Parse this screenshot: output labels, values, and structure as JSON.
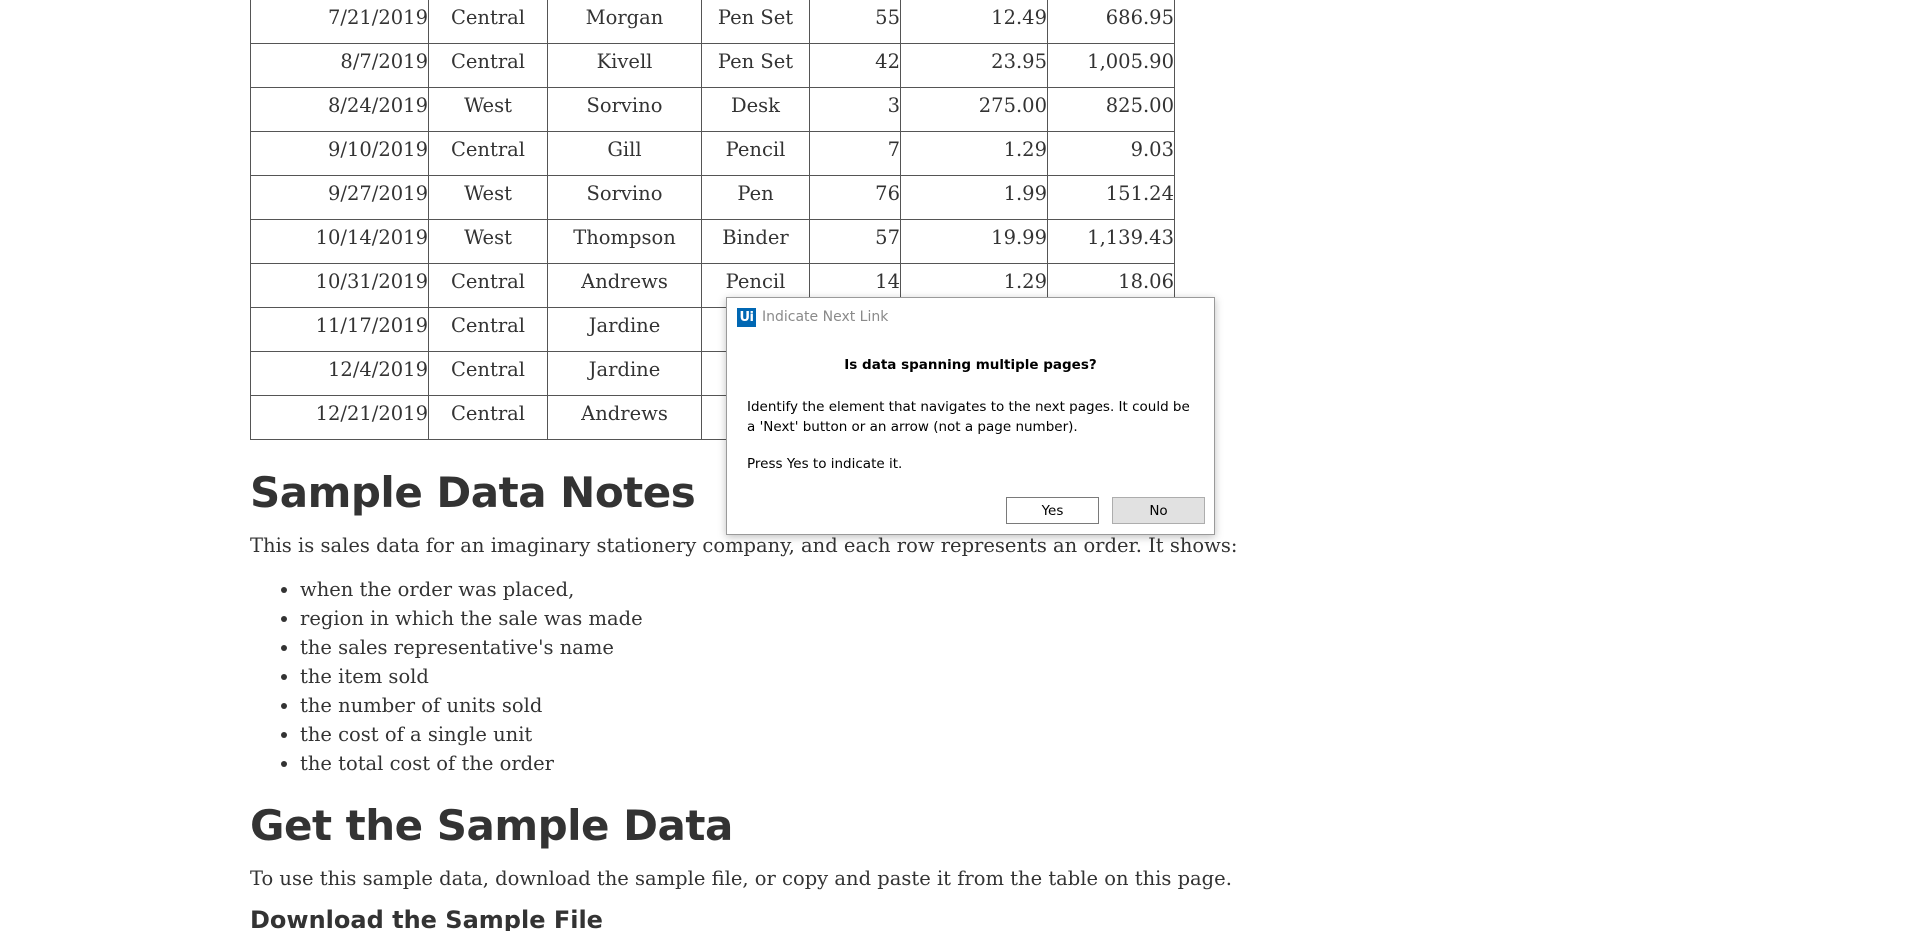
{
  "table": {
    "rows": [
      [
        "7/21/2019",
        "Central",
        "Morgan",
        "Pen Set",
        "55",
        "12.49",
        "686.95"
      ],
      [
        "8/7/2019",
        "Central",
        "Kivell",
        "Pen Set",
        "42",
        "23.95",
        "1,005.90"
      ],
      [
        "8/24/2019",
        "West",
        "Sorvino",
        "Desk",
        "3",
        "275.00",
        "825.00"
      ],
      [
        "9/10/2019",
        "Central",
        "Gill",
        "Pencil",
        "7",
        "1.29",
        "9.03"
      ],
      [
        "9/27/2019",
        "West",
        "Sorvino",
        "Pen",
        "76",
        "1.99",
        "151.24"
      ],
      [
        "10/14/2019",
        "West",
        "Thompson",
        "Binder",
        "57",
        "19.99",
        "1,139.43"
      ],
      [
        "10/31/2019",
        "Central",
        "Andrews",
        "Pencil",
        "14",
        "1.29",
        "18.06"
      ],
      [
        "11/17/2019",
        "Central",
        "Jardine",
        "",
        "",
        "",
        ""
      ],
      [
        "12/4/2019",
        "Central",
        "Jardine",
        "",
        "",
        "",
        ""
      ],
      [
        "12/21/2019",
        "Central",
        "Andrews",
        "",
        "",
        "",
        ""
      ]
    ]
  },
  "notes": {
    "heading": "Sample Data Notes",
    "intro": "This is sales data for an imaginary stationery company, and each row represents an order. It shows:",
    "items": [
      "when the order was placed,",
      "region in which the sale was made",
      "the sales representative's name",
      "the item sold",
      "the number of units sold",
      "the cost of a single unit",
      "the total cost of the order"
    ]
  },
  "get_data": {
    "heading": "Get the Sample Data",
    "intro": "To use this sample data, download the sample file, or copy and paste it from the table on this page.",
    "download_heading": "Download the Sample File"
  },
  "dialog": {
    "app_icon_text": "Ui",
    "app_icon_color": "#0067b3",
    "title": "Indicate Next Link",
    "question": "Is data spanning multiple pages?",
    "message": "Identify the element that navigates to the next pages. It could be a 'Next' button or an arrow (not a page number).",
    "prompt": "Press Yes to indicate it.",
    "yes_label": "Yes",
    "no_label": "No"
  }
}
